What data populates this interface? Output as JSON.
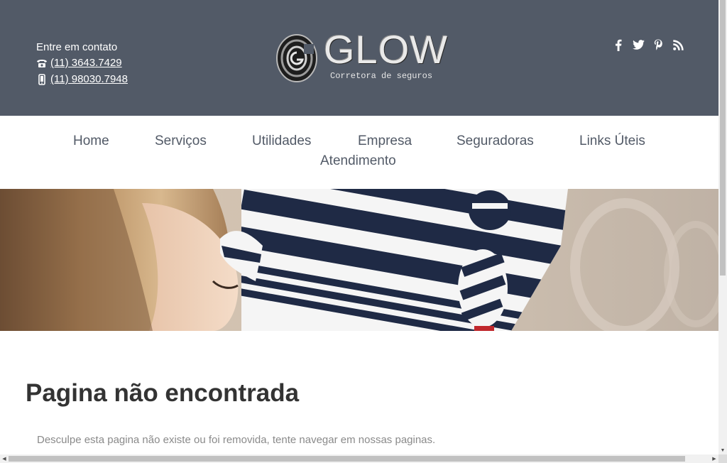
{
  "header": {
    "contact_title": "Entre em contato",
    "phone_landline": "(11)  3643.7429",
    "phone_mobile": "(11) 98030.7948",
    "brand_name": "GLOW",
    "brand_tagline": "Corretora de seguros",
    "social_icons": [
      "facebook-icon",
      "twitter-icon",
      "pinterest-icon",
      "rss-icon"
    ]
  },
  "nav": {
    "items": [
      "Home",
      "Serviços",
      "Utilidades",
      "Empresa",
      "Seguradoras",
      "Links Úteis",
      "Atendimento"
    ]
  },
  "content": {
    "title": "Pagina não encontrada",
    "text": "Desculpe esta pagina não existe ou foi removida, tente navegar em nossas paginas."
  },
  "colors": {
    "header_bg": "#525a67",
    "nav_text": "#525a67",
    "title_text": "#333333",
    "body_text": "#8a8a8a"
  }
}
